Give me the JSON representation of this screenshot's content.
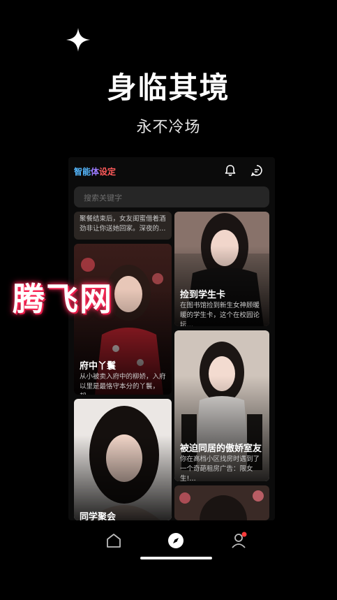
{
  "hero": {
    "headline": "身临其境",
    "subline": "永不冷场"
  },
  "app": {
    "brand": {
      "part1": "智能",
      "part2": "体",
      "part3": "设定"
    },
    "search_placeholder": "搜索关键字",
    "cards_left": [
      {
        "title": "",
        "desc": "聚餐结束后，女友闺蜜借着酒劲非让你送她回家。深夜的…"
      },
      {
        "title": "府中丫鬟",
        "desc": "从小被卖入府中的柳娇，入府以里是最恪守本分的丫鬟，却…"
      },
      {
        "title": "同学聚会",
        "desc": ""
      }
    ],
    "cards_right": [
      {
        "title": "捡到学生卡",
        "desc": "在图书馆捡到新生女神顾暖暖的学生卡，这个在校园论坛…"
      },
      {
        "title": "被迫同居的傲娇室友",
        "desc": "你在高档小区找房时遇到了一个奇葩租房广告：限女生!…"
      },
      {
        "title": "",
        "desc": ""
      }
    ]
  },
  "watermark": "腾飞网",
  "icons": {
    "sparkle": "sparkle-icon",
    "bell": "bell-icon",
    "chat": "chat-bubble-icon",
    "home": "home-icon",
    "discover": "compass-icon",
    "profile": "profile-icon"
  },
  "colors": {
    "background": "#000000",
    "brand_blue": "#55b8ff",
    "brand_purple": "#9b7bff",
    "brand_red": "#ff5a5a",
    "notification_dot": "#ff3b3b",
    "watermark_glow": "#ff2a5a"
  }
}
